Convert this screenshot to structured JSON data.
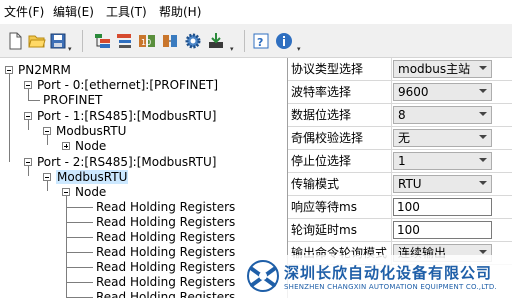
{
  "menu": {
    "items": [
      {
        "label": "文件(F)"
      },
      {
        "label": "编辑(E)"
      },
      {
        "label": "工具(T)"
      },
      {
        "label": "帮助(H)"
      }
    ]
  },
  "toolbar": {
    "icons": [
      "new-file-icon",
      "open-folder-icon",
      "save-icon",
      "add-port-icon",
      "add-module-icon",
      "add-node-icon",
      "add-command-icon",
      "settings-icon",
      "download-icon",
      "help-icon",
      "info-icon"
    ]
  },
  "tree": {
    "root": "PN2MRM",
    "port0": "Port - 0:[ethernet]:[PROFINET]",
    "port0_child": "PROFINET",
    "port1": "Port - 1:[RS485]:[ModbusRTU]",
    "port1_child": "ModbusRTU",
    "port1_node": "Node",
    "port2": "Port - 2:[RS485]:[ModbusRTU]",
    "port2_child": "ModbusRTU",
    "port2_node": "Node",
    "registers": [
      "Read Holding Registers",
      "Read Holding Registers",
      "Read Holding Registers",
      "Read Holding Registers",
      "Read Holding Registers",
      "Read Holding Registers",
      "Read Holding Registers"
    ]
  },
  "properties": [
    {
      "label": "协议类型选择",
      "value": "modbus主站",
      "kind": "combo"
    },
    {
      "label": "波特率选择",
      "value": "9600",
      "kind": "combo"
    },
    {
      "label": "数据位选择",
      "value": "8",
      "kind": "combo"
    },
    {
      "label": "奇偶校验选择",
      "value": "无",
      "kind": "combo"
    },
    {
      "label": "停止位选择",
      "value": "1",
      "kind": "combo"
    },
    {
      "label": "传输模式",
      "value": "RTU",
      "kind": "combo"
    },
    {
      "label": "响应等待ms",
      "value": "100",
      "kind": "edit"
    },
    {
      "label": "轮询延时ms",
      "value": "100",
      "kind": "edit"
    },
    {
      "label": "输出命令轮询模式",
      "value": "连续输出",
      "kind": "combo"
    }
  ],
  "watermark": {
    "company_cn": "深圳长欣自动化设备有限公司",
    "company_en": "SHENZHEN CHANGXIN AUTOMATION EQUIPMENT CO.,LTD.",
    "brand_color": "#1f5fa8"
  },
  "colors": {
    "selection": "#cce8ff",
    "toolbar_bg": "#f0f0f0"
  }
}
